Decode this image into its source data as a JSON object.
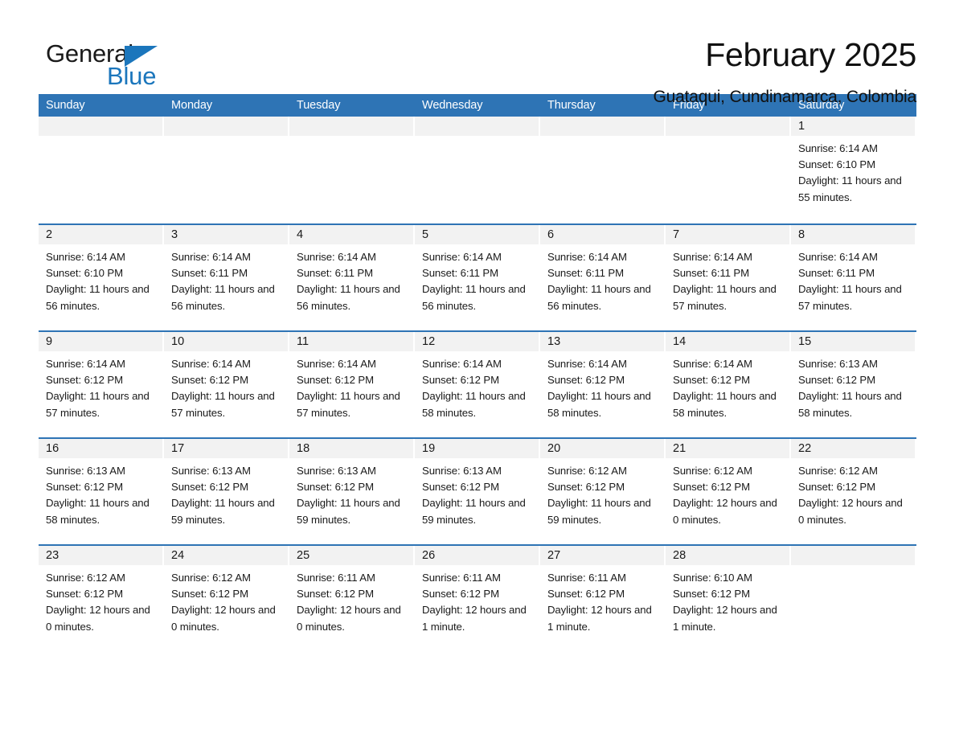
{
  "brand": {
    "name_part1": "General",
    "name_part2": "Blue",
    "accent_color": "#1b76bc"
  },
  "header": {
    "title": "February 2025",
    "subtitle": "Guataqui, Cundinamarca, Colombia"
  },
  "calendar": {
    "header_color": "#2e74b5",
    "weekdays": [
      "Sunday",
      "Monday",
      "Tuesday",
      "Wednesday",
      "Thursday",
      "Friday",
      "Saturday"
    ],
    "weeks": [
      [
        {
          "day": "",
          "sunrise": "",
          "sunset": "",
          "daylight": ""
        },
        {
          "day": "",
          "sunrise": "",
          "sunset": "",
          "daylight": ""
        },
        {
          "day": "",
          "sunrise": "",
          "sunset": "",
          "daylight": ""
        },
        {
          "day": "",
          "sunrise": "",
          "sunset": "",
          "daylight": ""
        },
        {
          "day": "",
          "sunrise": "",
          "sunset": "",
          "daylight": ""
        },
        {
          "day": "",
          "sunrise": "",
          "sunset": "",
          "daylight": ""
        },
        {
          "day": "1",
          "sunrise": "Sunrise: 6:14 AM",
          "sunset": "Sunset: 6:10 PM",
          "daylight": "Daylight: 11 hours and 55 minutes."
        }
      ],
      [
        {
          "day": "2",
          "sunrise": "Sunrise: 6:14 AM",
          "sunset": "Sunset: 6:10 PM",
          "daylight": "Daylight: 11 hours and 56 minutes."
        },
        {
          "day": "3",
          "sunrise": "Sunrise: 6:14 AM",
          "sunset": "Sunset: 6:11 PM",
          "daylight": "Daylight: 11 hours and 56 minutes."
        },
        {
          "day": "4",
          "sunrise": "Sunrise: 6:14 AM",
          "sunset": "Sunset: 6:11 PM",
          "daylight": "Daylight: 11 hours and 56 minutes."
        },
        {
          "day": "5",
          "sunrise": "Sunrise: 6:14 AM",
          "sunset": "Sunset: 6:11 PM",
          "daylight": "Daylight: 11 hours and 56 minutes."
        },
        {
          "day": "6",
          "sunrise": "Sunrise: 6:14 AM",
          "sunset": "Sunset: 6:11 PM",
          "daylight": "Daylight: 11 hours and 56 minutes."
        },
        {
          "day": "7",
          "sunrise": "Sunrise: 6:14 AM",
          "sunset": "Sunset: 6:11 PM",
          "daylight": "Daylight: 11 hours and 57 minutes."
        },
        {
          "day": "8",
          "sunrise": "Sunrise: 6:14 AM",
          "sunset": "Sunset: 6:11 PM",
          "daylight": "Daylight: 11 hours and 57 minutes."
        }
      ],
      [
        {
          "day": "9",
          "sunrise": "Sunrise: 6:14 AM",
          "sunset": "Sunset: 6:12 PM",
          "daylight": "Daylight: 11 hours and 57 minutes."
        },
        {
          "day": "10",
          "sunrise": "Sunrise: 6:14 AM",
          "sunset": "Sunset: 6:12 PM",
          "daylight": "Daylight: 11 hours and 57 minutes."
        },
        {
          "day": "11",
          "sunrise": "Sunrise: 6:14 AM",
          "sunset": "Sunset: 6:12 PM",
          "daylight": "Daylight: 11 hours and 57 minutes."
        },
        {
          "day": "12",
          "sunrise": "Sunrise: 6:14 AM",
          "sunset": "Sunset: 6:12 PM",
          "daylight": "Daylight: 11 hours and 58 minutes."
        },
        {
          "day": "13",
          "sunrise": "Sunrise: 6:14 AM",
          "sunset": "Sunset: 6:12 PM",
          "daylight": "Daylight: 11 hours and 58 minutes."
        },
        {
          "day": "14",
          "sunrise": "Sunrise: 6:14 AM",
          "sunset": "Sunset: 6:12 PM",
          "daylight": "Daylight: 11 hours and 58 minutes."
        },
        {
          "day": "15",
          "sunrise": "Sunrise: 6:13 AM",
          "sunset": "Sunset: 6:12 PM",
          "daylight": "Daylight: 11 hours and 58 minutes."
        }
      ],
      [
        {
          "day": "16",
          "sunrise": "Sunrise: 6:13 AM",
          "sunset": "Sunset: 6:12 PM",
          "daylight": "Daylight: 11 hours and 58 minutes."
        },
        {
          "day": "17",
          "sunrise": "Sunrise: 6:13 AM",
          "sunset": "Sunset: 6:12 PM",
          "daylight": "Daylight: 11 hours and 59 minutes."
        },
        {
          "day": "18",
          "sunrise": "Sunrise: 6:13 AM",
          "sunset": "Sunset: 6:12 PM",
          "daylight": "Daylight: 11 hours and 59 minutes."
        },
        {
          "day": "19",
          "sunrise": "Sunrise: 6:13 AM",
          "sunset": "Sunset: 6:12 PM",
          "daylight": "Daylight: 11 hours and 59 minutes."
        },
        {
          "day": "20",
          "sunrise": "Sunrise: 6:12 AM",
          "sunset": "Sunset: 6:12 PM",
          "daylight": "Daylight: 11 hours and 59 minutes."
        },
        {
          "day": "21",
          "sunrise": "Sunrise: 6:12 AM",
          "sunset": "Sunset: 6:12 PM",
          "daylight": "Daylight: 12 hours and 0 minutes."
        },
        {
          "day": "22",
          "sunrise": "Sunrise: 6:12 AM",
          "sunset": "Sunset: 6:12 PM",
          "daylight": "Daylight: 12 hours and 0 minutes."
        }
      ],
      [
        {
          "day": "23",
          "sunrise": "Sunrise: 6:12 AM",
          "sunset": "Sunset: 6:12 PM",
          "daylight": "Daylight: 12 hours and 0 minutes."
        },
        {
          "day": "24",
          "sunrise": "Sunrise: 6:12 AM",
          "sunset": "Sunset: 6:12 PM",
          "daylight": "Daylight: 12 hours and 0 minutes."
        },
        {
          "day": "25",
          "sunrise": "Sunrise: 6:11 AM",
          "sunset": "Sunset: 6:12 PM",
          "daylight": "Daylight: 12 hours and 0 minutes."
        },
        {
          "day": "26",
          "sunrise": "Sunrise: 6:11 AM",
          "sunset": "Sunset: 6:12 PM",
          "daylight": "Daylight: 12 hours and 1 minute."
        },
        {
          "day": "27",
          "sunrise": "Sunrise: 6:11 AM",
          "sunset": "Sunset: 6:12 PM",
          "daylight": "Daylight: 12 hours and 1 minute."
        },
        {
          "day": "28",
          "sunrise": "Sunrise: 6:10 AM",
          "sunset": "Sunset: 6:12 PM",
          "daylight": "Daylight: 12 hours and 1 minute."
        },
        {
          "day": "",
          "sunrise": "",
          "sunset": "",
          "daylight": ""
        }
      ]
    ]
  }
}
